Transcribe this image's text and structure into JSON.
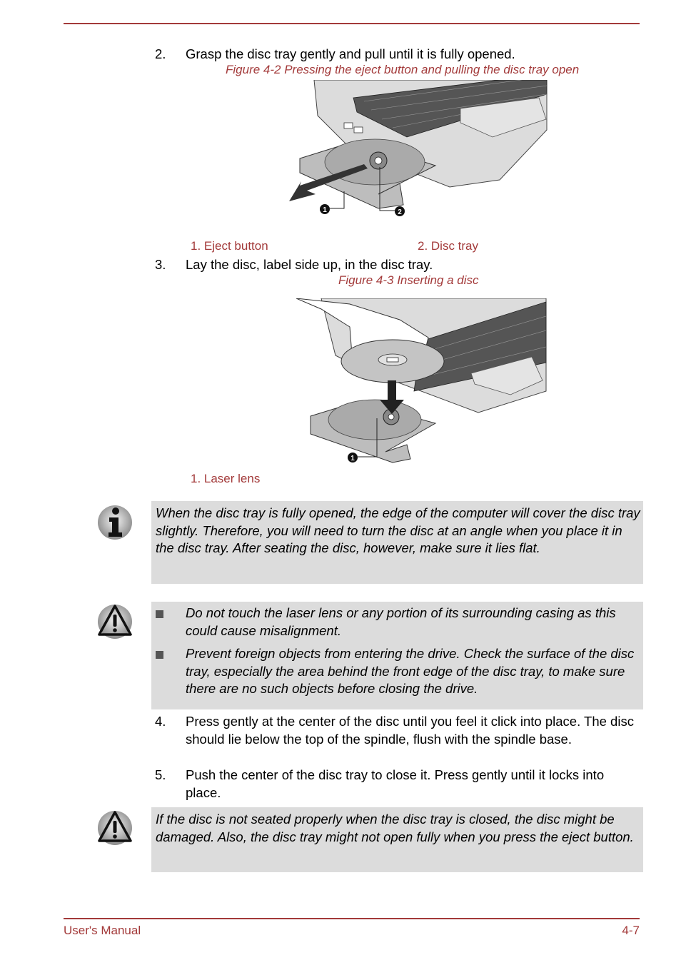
{
  "header": {
    "rule_color": "#a33a3a"
  },
  "steps": [
    {
      "number": "2.",
      "text": "Grasp the disc tray gently and pull until it is fully opened."
    },
    {
      "number": "3.",
      "text": "Lay the disc, label side up, in the disc tray."
    },
    {
      "number": "4.",
      "text": "Press gently at the center of the disc until you feel it click into place. The disc should lie below the top of the spindle, flush with the spindle base."
    },
    {
      "number": "5.",
      "text": "Push the center of the disc tray to close it. Press gently until it locks into place."
    }
  ],
  "figures": [
    {
      "caption": "Figure 4-2 Pressing the eject button and pulling the disc tray open",
      "callouts": [
        "1",
        "2"
      ],
      "legend": [
        "1. Eject button",
        "2. Disc tray"
      ]
    },
    {
      "caption": "Figure 4-3 Inserting a disc",
      "callouts": [
        "1"
      ],
      "legend": [
        "1. Laser lens"
      ]
    }
  ],
  "notes": [
    {
      "type": "info",
      "icon": "info-icon",
      "text": "When the disc tray is fully opened, the edge of the computer will cover the disc tray slightly. Therefore, you will need to turn the disc at an angle when you place it in the disc tray. After seating the disc, however, make sure it lies flat."
    },
    {
      "type": "caution",
      "icon": "warning-icon",
      "items": [
        "Do not touch the laser lens or any portion of its surrounding casing as this could cause misalignment.",
        "Prevent foreign objects from entering the drive. Check the surface of the disc tray, especially the area behind the front edge of the disc tray, to make sure there are no such objects before closing the drive."
      ]
    },
    {
      "type": "caution",
      "icon": "warning-icon",
      "text": "If the disc is not seated properly when the disc tray is closed, the disc might be damaged. Also, the disc tray might not open fully when you press the eject button."
    }
  ],
  "footer": {
    "title": "User's Manual",
    "page": "4-7"
  }
}
